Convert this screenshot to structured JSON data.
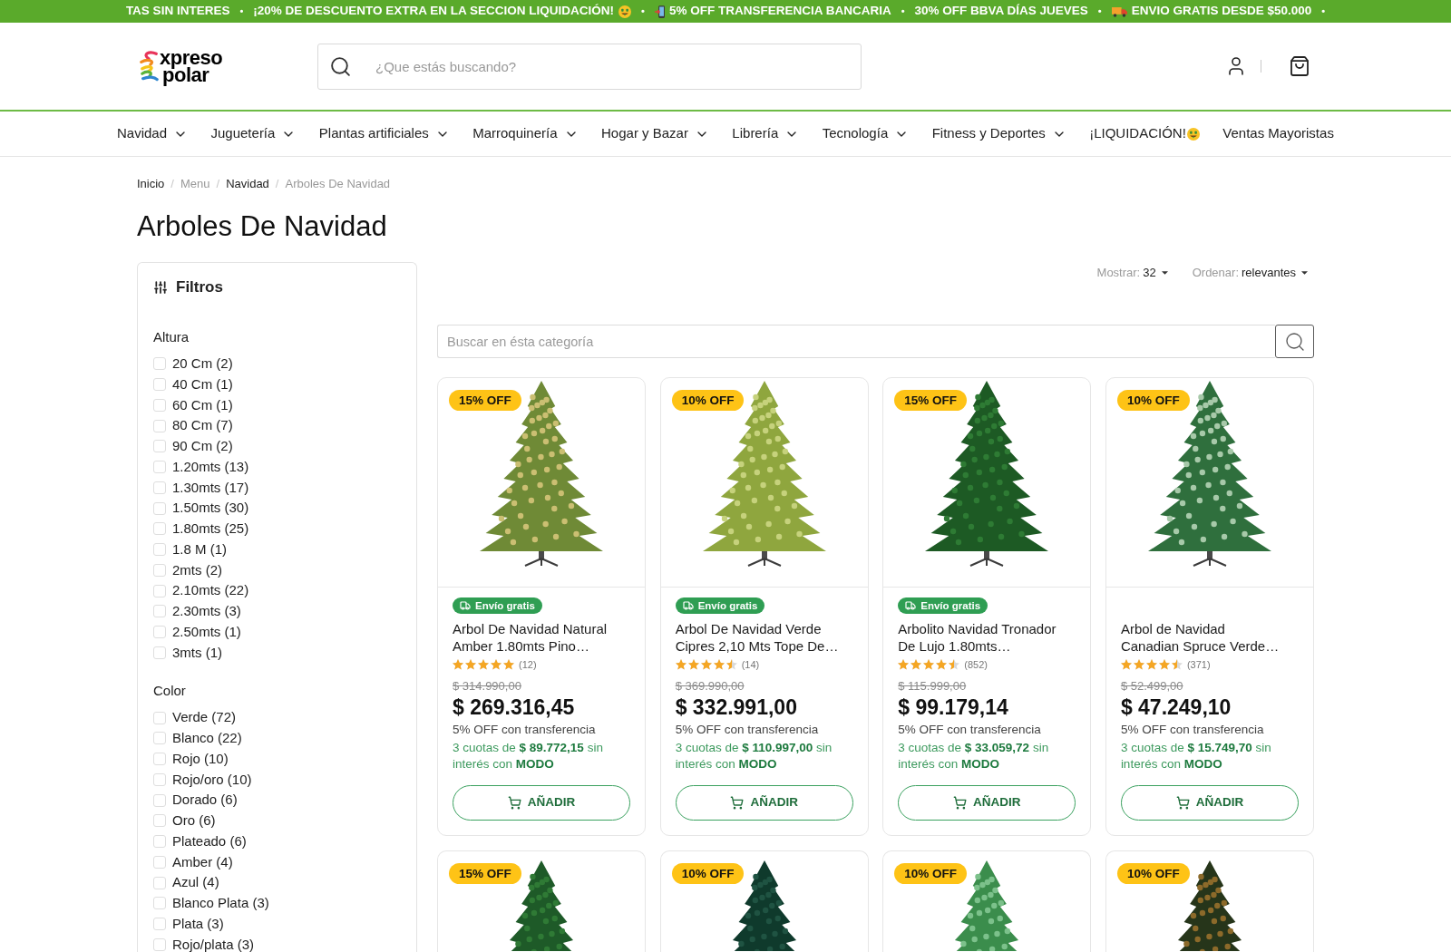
{
  "banner": {
    "separator": "•",
    "items": [
      {
        "kind": "text",
        "text": "TAS SIN INTERES"
      },
      {
        "kind": "liquidation",
        "text": "¡20% DE DESCUENTO EXTRA EN LA SECCION LIQUIDACIÓN!"
      },
      {
        "kind": "transfer",
        "text": "5% OFF TRANSFERENCIA BANCARIA"
      },
      {
        "kind": "text",
        "text": "30% OFF BBVA DÍAS JUEVES"
      },
      {
        "kind": "shipping",
        "text": "ENVIO GRATIS DESDE $50.000"
      }
    ]
  },
  "header": {
    "logo": {
      "line_1": "xpreso",
      "line_2": "polar"
    },
    "search": {
      "placeholder": "¿Que estás buscando?"
    }
  },
  "nav": [
    {
      "label": "Navidad",
      "kind": "dropdown"
    },
    {
      "label": "Juguetería",
      "kind": "dropdown"
    },
    {
      "label": "Plantas artificiales",
      "kind": "dropdown"
    },
    {
      "label": "Marroquinería",
      "kind": "dropdown"
    },
    {
      "label": "Hogar y Bazar",
      "kind": "dropdown"
    },
    {
      "label": "Librería",
      "kind": "dropdown"
    },
    {
      "label": "Tecnología",
      "kind": "dropdown"
    },
    {
      "label": "Fitness y Deportes",
      "kind": "dropdown"
    },
    {
      "label": "¡LIQUIDACIÓN!",
      "kind": "promo"
    },
    {
      "label": "Ventas Mayoristas",
      "kind": "link"
    }
  ],
  "breadcrumb": {
    "separator": "/",
    "items": [
      {
        "label": "Inicio",
        "link": true
      },
      {
        "label": "Menu",
        "link": false
      },
      {
        "label": "Navidad",
        "link": true
      },
      {
        "label": "Arboles De Navidad",
        "link": false
      }
    ]
  },
  "title": "Arboles De Navidad",
  "filters": {
    "title": "Filtros",
    "groups": [
      {
        "name": "Altura",
        "options": [
          {
            "label": "20 Cm (2)",
            "checked": false
          },
          {
            "label": "40 Cm (1)",
            "checked": false
          },
          {
            "label": "60 Cm (1)",
            "checked": false
          },
          {
            "label": "80 Cm (7)",
            "checked": false
          },
          {
            "label": "90 Cm (2)",
            "checked": false
          },
          {
            "label": "1.20mts (13)",
            "checked": false
          },
          {
            "label": "1.30mts (17)",
            "checked": false
          },
          {
            "label": "1.50mts (30)",
            "checked": false
          },
          {
            "label": "1.80mts (25)",
            "checked": false
          },
          {
            "label": "1.8 M (1)",
            "checked": false
          },
          {
            "label": "2mts (2)",
            "checked": false
          },
          {
            "label": "2.10mts (22)",
            "checked": false
          },
          {
            "label": "2.30mts (3)",
            "checked": false
          },
          {
            "label": "2.50mts (1)",
            "checked": false
          },
          {
            "label": "3mts (1)",
            "checked": false
          }
        ]
      },
      {
        "name": "Color",
        "options": [
          {
            "label": "Verde (72)",
            "checked": false
          },
          {
            "label": "Blanco (22)",
            "checked": false
          },
          {
            "label": "Rojo (10)",
            "checked": false
          },
          {
            "label": "Rojo/oro (10)",
            "checked": false
          },
          {
            "label": "Dorado (6)",
            "checked": false
          },
          {
            "label": "Oro (6)",
            "checked": false
          },
          {
            "label": "Plateado (6)",
            "checked": false
          },
          {
            "label": "Amber (4)",
            "checked": false
          },
          {
            "label": "Azul (4)",
            "checked": false
          },
          {
            "label": "Blanco Plata (3)",
            "checked": false
          },
          {
            "label": "Plata (3)",
            "checked": false
          },
          {
            "label": "Rojo/plata (3)",
            "checked": false
          }
        ]
      }
    ]
  },
  "toolbar": {
    "controls": [
      {
        "label": "Mostrar:",
        "value": "32"
      },
      {
        "label": "Ordenar:",
        "value": "relevantes"
      }
    ],
    "search": {
      "placeholder": "Buscar en ésta categoría"
    }
  },
  "products": [
    {
      "discount": "15% OFF",
      "free_shipping": true,
      "shipping_label": "Envío gratis",
      "title": "Arbol De Navidad Natural\nAmber 1.80mts Pino…",
      "stars": 5,
      "reviews": "(12)",
      "old_price": "$ 314.990,00",
      "price": "$ 269.316,45",
      "transfer_note": "5% OFF con transferencia",
      "installments": "3 cuotas de **$ 89.772,15** sin\ninterés con **MODO**",
      "button": "AÑADIR"
    },
    {
      "discount": "10% OFF",
      "free_shipping": true,
      "shipping_label": "Envío gratis",
      "title": "Arbol De Navidad Verde\nCipres 2,10 Mts Tope De…",
      "stars": 4.5,
      "reviews": "(14)",
      "old_price": "$ 369.990,00",
      "price": "$ 332.991,00",
      "transfer_note": "5% OFF con transferencia",
      "installments": "3 cuotas de **$ 110.997,00** sin\ninterés con **MODO**",
      "button": "AÑADIR"
    },
    {
      "discount": "15% OFF",
      "free_shipping": true,
      "shipping_label": "Envío gratis",
      "title": "Arbolito Navidad Tronador\nDe Lujo 1.80mts…",
      "stars": 4.5,
      "reviews": "(852)",
      "old_price": "$ 115.999,00",
      "price": "$ 99.179,14",
      "transfer_note": "5% OFF con transferencia",
      "installments": "3 cuotas de **$ 33.059,72** sin\ninterés con **MODO**",
      "button": "AÑADIR"
    },
    {
      "discount": "10% OFF",
      "free_shipping": false,
      "title": "Arbol de Navidad\nCanadian Spruce Verde…",
      "stars": 4.5,
      "reviews": "(371)",
      "old_price": "$ 52.499,00",
      "price": "$ 47.249,10",
      "transfer_note": "5% OFF con transferencia",
      "installments": "3 cuotas de **$ 15.749,70** sin\ninterés con **MODO**",
      "button": "AÑADIR"
    }
  ],
  "more_products": [
    {
      "discount": "15% OFF"
    },
    {
      "discount": "10% OFF"
    },
    {
      "discount": "10% OFF"
    },
    {
      "discount": "10% OFF"
    }
  ]
}
